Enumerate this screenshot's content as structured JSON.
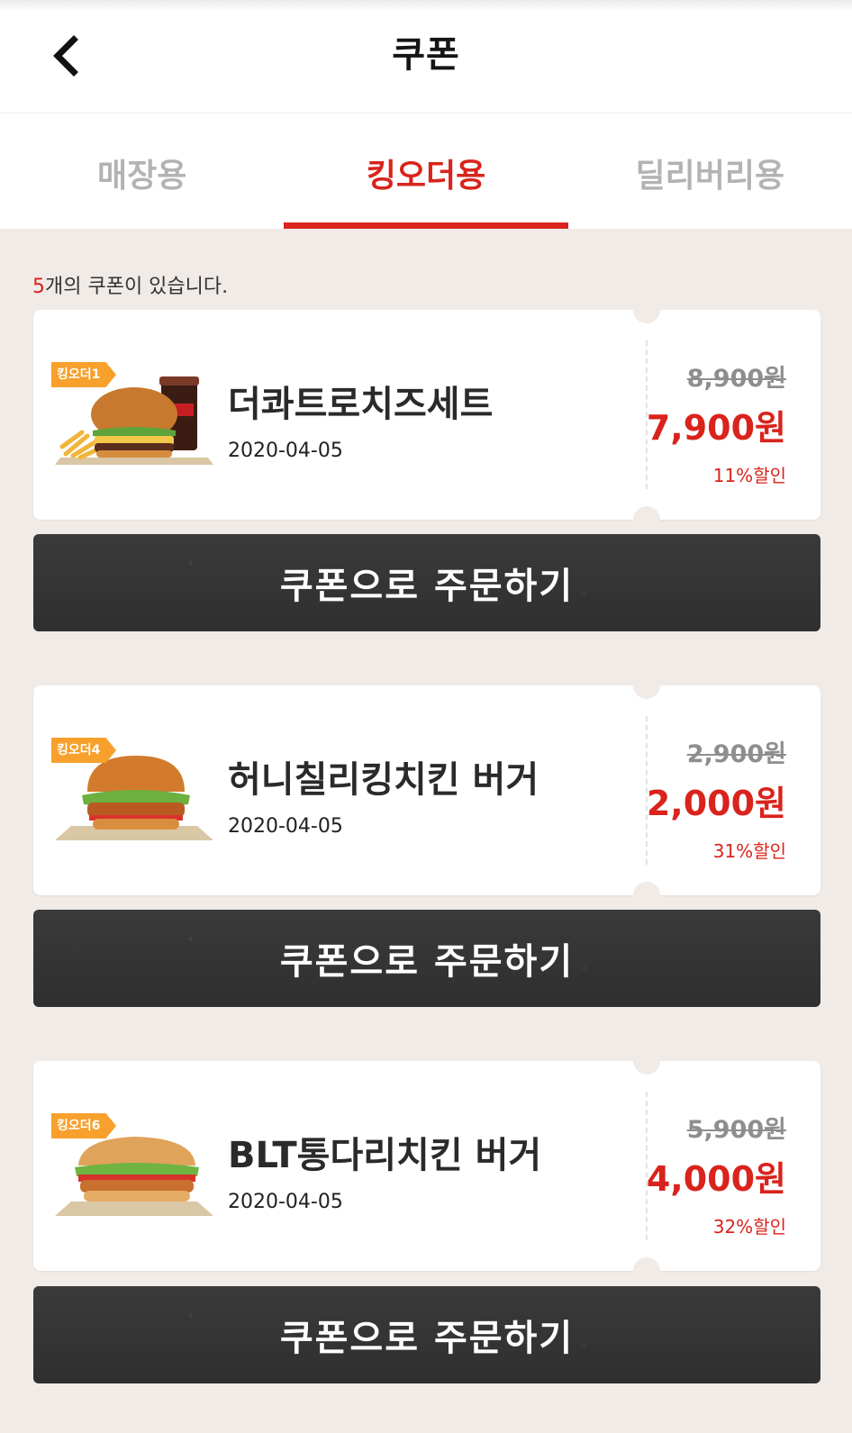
{
  "header": {
    "title": "쿠폰",
    "back_icon": "chevron-left-icon"
  },
  "tabs": [
    {
      "label": "매장용",
      "active": false
    },
    {
      "label": "킹오더용",
      "active": true
    },
    {
      "label": "딜리버리용",
      "active": false
    }
  ],
  "coupon_count": {
    "number": "5",
    "text": "개의 쿠폰이 있습니다."
  },
  "coupons": [
    {
      "badge": "킹오더1",
      "name": "더콰트로치즈세트",
      "date": "2020-04-05",
      "original_price": "8,900원",
      "sale_price": "7,900원",
      "discount": "11%할인",
      "button_label": "쿠폰으로 주문하기",
      "image": "burger-set-with-fries-and-cola"
    },
    {
      "badge": "킹오더4",
      "name": "허니칠리킹치킨 버거",
      "date": "2020-04-05",
      "original_price": "2,900원",
      "sale_price": "2,000원",
      "discount": "31%할인",
      "button_label": "쿠폰으로 주문하기",
      "image": "chicken-burger"
    },
    {
      "badge": "킹오더6",
      "name": "BLT통다리치킨 버거",
      "date": "2020-04-05",
      "original_price": "5,900원",
      "sale_price": "4,000원",
      "discount": "32%할인",
      "button_label": "쿠폰으로 주문하기",
      "image": "blt-chicken-burger"
    }
  ],
  "colors": {
    "accent": "#d9231c",
    "badge": "#f7a02c",
    "background": "#f1ebe7",
    "button": "#333333"
  }
}
